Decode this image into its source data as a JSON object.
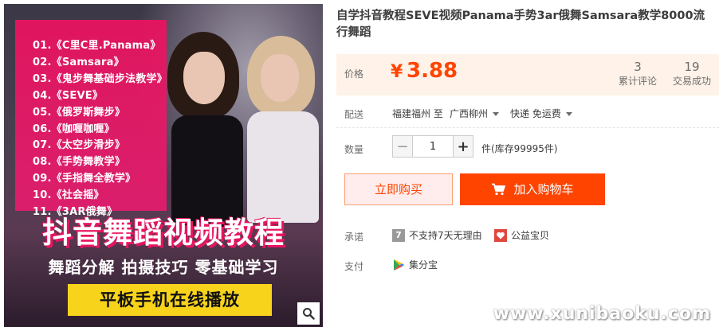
{
  "image": {
    "lessons": [
      "01.《C里C里.Panama》",
      "02.《Samsara》",
      "03.《鬼步舞基础步法教学》",
      "04.《SEVE》",
      "05.《俄罗斯舞步》",
      "06.《咖喱咖喱》",
      "07.《太空步滑步》",
      "08.《手势舞教学》",
      "09.《手指舞全教学》",
      "10.《社会摇》",
      "11.《3AR俄舞》"
    ],
    "banner_title": "抖音舞蹈视频教程",
    "banner_subtitle": "舞蹈分解 拍摄技巧 零基础学习",
    "banner_strip": "平板手机在线播放",
    "accent_color": "#e8145f",
    "strip_color": "#f8d31c",
    "zoom_icon": "search-icon"
  },
  "product": {
    "title": "自学抖音教程SEVE视频Panama手势3ar俄舞Samsara教学8000流行舞蹈"
  },
  "price": {
    "label": "价格",
    "currency": "¥",
    "value": "3.88",
    "color": "#ff4400",
    "reviews_count": "3",
    "reviews_label": "累计评论",
    "sales_count": "19",
    "sales_label": "交易成功"
  },
  "shipping": {
    "label": "配送",
    "from": "福建福州 至",
    "to": "广西柳州",
    "fee": "快递 免运费"
  },
  "quantity": {
    "label": "数量",
    "minus": "−",
    "value": "1",
    "plus": "+",
    "stock": "件(库存99995件)"
  },
  "actions": {
    "buy_now": "立即购买",
    "add_to_cart": "加入购物车"
  },
  "promise": {
    "label": "承诺",
    "item1_icon": "7",
    "item1": "不支持7天无理由",
    "item2": "公益宝贝"
  },
  "payment": {
    "label": "支付",
    "method": "集分宝"
  },
  "watermark": "www.xunibaoku.com"
}
